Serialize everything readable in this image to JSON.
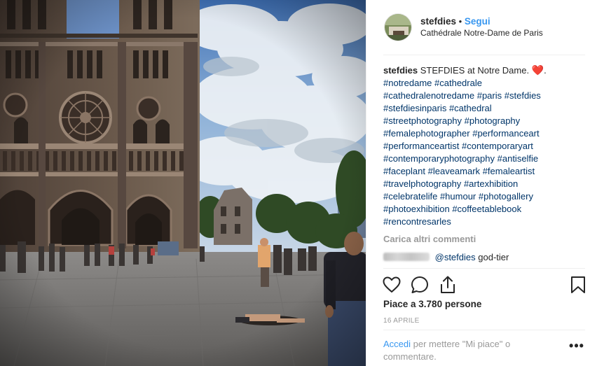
{
  "header": {
    "username": "stefdies",
    "separator": "•",
    "follow_label": "Segui",
    "location": "Cathédrale Notre-Dame de Paris"
  },
  "caption": {
    "username": "stefdies",
    "text": "STEFDIES at Notre Dame.",
    "emoji": "❤️",
    "end": ".",
    "hashtags": [
      "#notredame",
      "#cathedrale",
      "#cathedralenotredame",
      "#paris",
      "#stefdies",
      "#stefdiesinparis",
      "#cathedral",
      "#streetphotography",
      "#photography",
      "#femalephotographer",
      "#performanceart",
      "#performanceartist",
      "#contemporaryart",
      "#contemporaryphotography",
      "#antiselfie",
      "#faceplant",
      "#leaveamark",
      "#femaleartist",
      "#travelphotography",
      "#artexhibition",
      "#celebratelife",
      "#humour",
      "#photogallery",
      "#photoexhibition",
      "#coffeetablebook",
      "#rencontresarles"
    ]
  },
  "comments": {
    "load_more_label": "Carica altri commenti",
    "items": [
      {
        "mention": "@stefdies",
        "text": "god-tier"
      }
    ]
  },
  "actions": {
    "like_icon": "heart-outline-icon",
    "comment_icon": "comment-bubble-icon",
    "share_icon": "share-icon",
    "save_icon": "bookmark-icon"
  },
  "likes_text": "Piace a 3.780 persone",
  "date_text": "16 APRILE",
  "login_prompt": {
    "link": "Accedi",
    "text": "per mettere \"Mi piace\" o commentare."
  },
  "more_options_label": "•••",
  "colors": {
    "link_blue": "#3897f0",
    "hashtag_blue": "#003569",
    "muted": "#999999",
    "heart_red": "#c51f2f"
  }
}
